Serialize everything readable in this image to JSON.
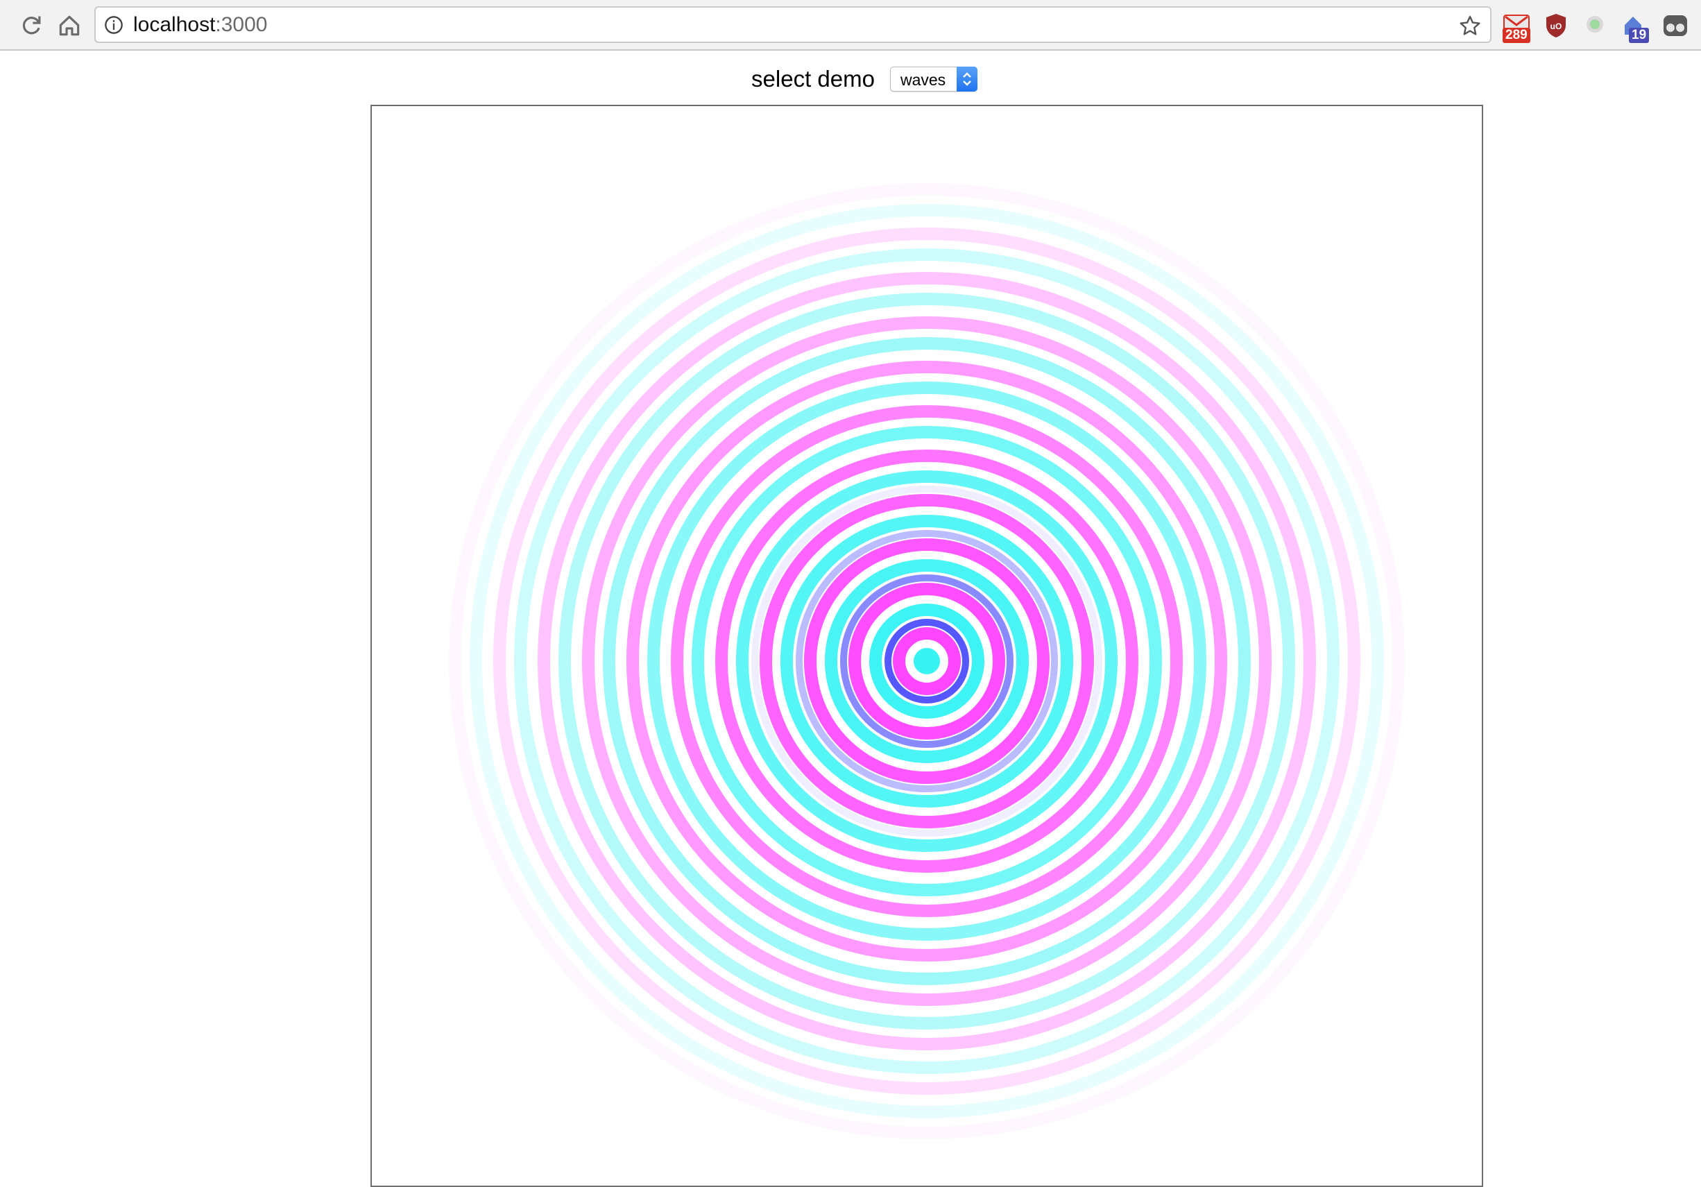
{
  "browser": {
    "url_host": "localhost",
    "url_port": ":3000",
    "extensions": [
      {
        "name": "gmail-extension",
        "badge": "289",
        "badge_color": "#d93025"
      },
      {
        "name": "ublock-extension",
        "badge": "",
        "badge_color": ""
      },
      {
        "name": "status-dot-extension",
        "badge": "",
        "badge_color": ""
      },
      {
        "name": "house-extension",
        "badge": "19",
        "badge_color": "#4b4bb5"
      },
      {
        "name": "ghostery-extension",
        "badge": "",
        "badge_color": ""
      }
    ]
  },
  "page": {
    "select_label": "select demo",
    "select_value": "waves"
  },
  "canvas": {
    "demo": "waves",
    "colors": {
      "cyan": "#39f3f3",
      "magenta": "#ff44ff",
      "blue": "#2a2cff",
      "white": "#ffffff"
    }
  }
}
